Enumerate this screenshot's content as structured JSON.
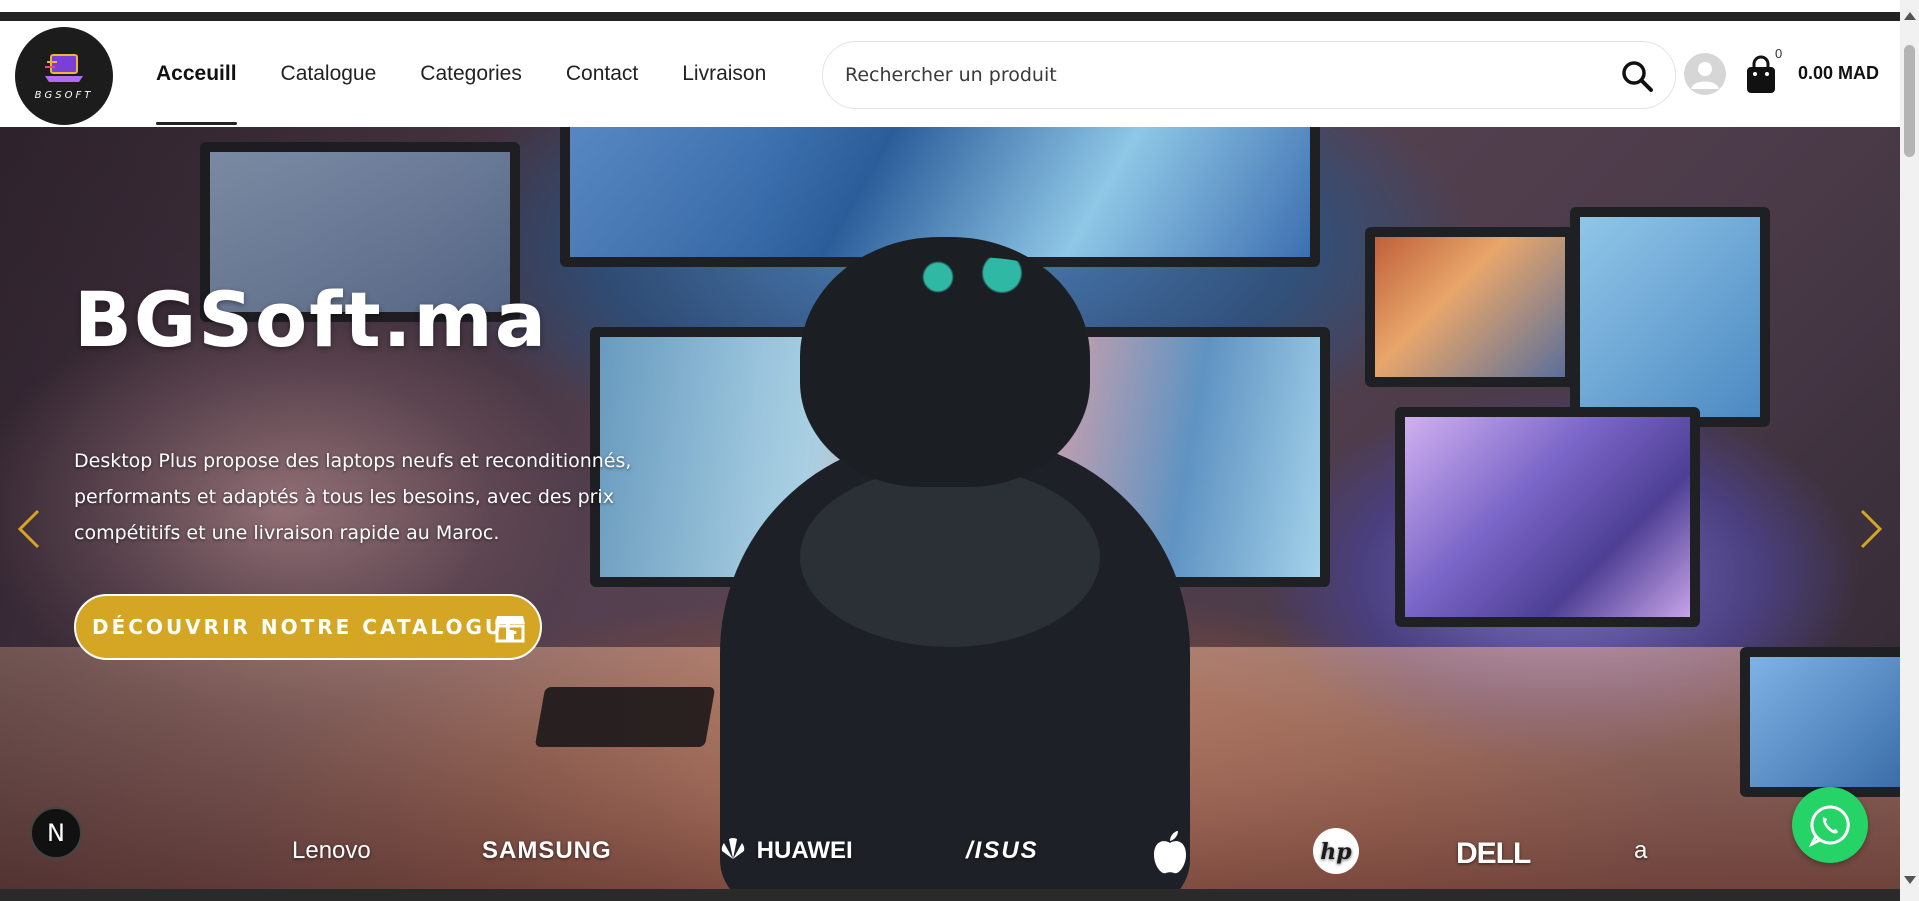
{
  "header": {
    "logo_text": "BGSOFT",
    "nav": [
      {
        "label": "Acceuill",
        "active": true
      },
      {
        "label": "Catalogue",
        "active": false
      },
      {
        "label": "Categories",
        "active": false
      },
      {
        "label": "Contact",
        "active": false
      },
      {
        "label": "Livraison",
        "active": false
      }
    ],
    "search": {
      "placeholder": "Rechercher un produit",
      "icon": "search-icon"
    },
    "user_icon": "user-icon",
    "cart": {
      "icon": "shopping-bag-icon",
      "count": "0",
      "total": "0.00 MAD"
    }
  },
  "hero": {
    "title": "BGSoft.ma",
    "description": "Desktop Plus propose des laptops neufs et reconditionnés, performants et adaptés à tous les besoins, avec des prix compétitifs et une livraison rapide au Maroc.",
    "cta_label": "DÉCOUVRIR NOTRE CATALOGUE",
    "cta_icon": "store-icon",
    "prev_icon": "chevron-left-icon",
    "next_icon": "chevron-right-icon",
    "accent_color": "#d4a623"
  },
  "brands": [
    "Lenovo",
    "SAMSUNG",
    "HUAWEI",
    "/ISUS",
    "apple",
    "hp",
    "DELL",
    "a"
  ],
  "floating": {
    "n_badge": "N",
    "whatsapp_icon": "whatsapp-icon",
    "whatsapp_color": "#25d366"
  }
}
